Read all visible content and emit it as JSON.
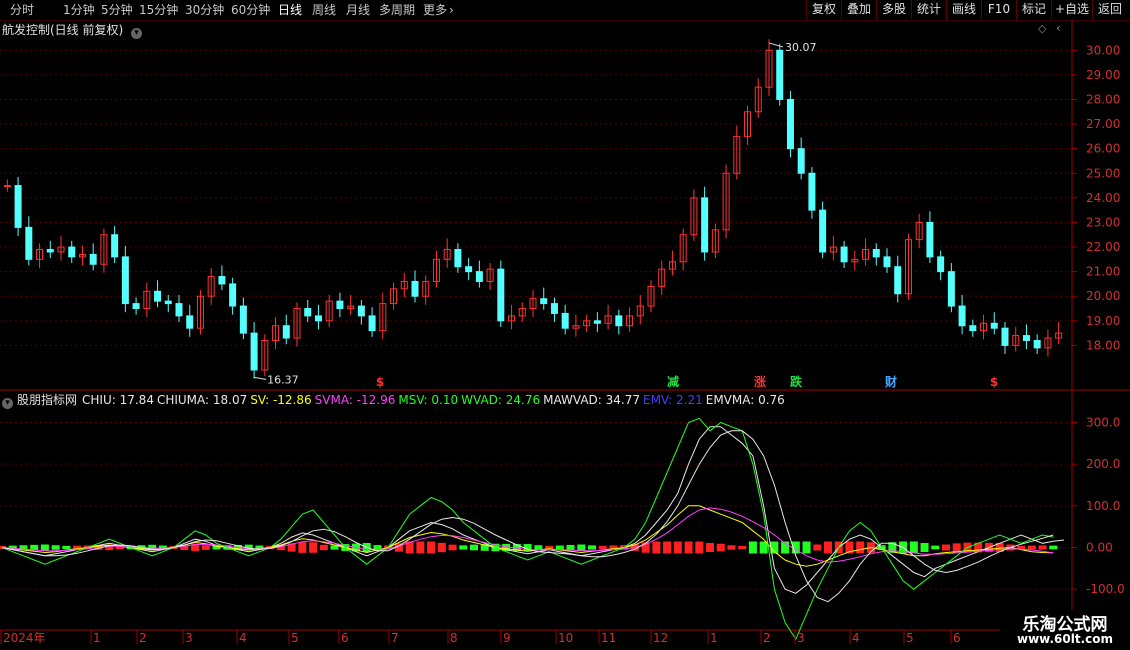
{
  "toolbar": {
    "timeframes": [
      "分时",
      "1分钟",
      "5分钟",
      "15分钟",
      "30分钟",
      "60分钟",
      "日线",
      "周线",
      "月线",
      "多周期",
      "更多"
    ],
    "active": "日线",
    "right_buttons": [
      "复权",
      "叠加",
      "多股",
      "统计",
      "画线",
      "F10",
      "标记",
      "+自选",
      "返回"
    ]
  },
  "main_panel": {
    "title": "航发控制(日线 前复权)",
    "high_label": "30.07",
    "low_label": "16.37",
    "y_ticks": [
      "30.00",
      "29.00",
      "28.00",
      "27.00",
      "26.00",
      "25.00",
      "24.00",
      "23.00",
      "22.00",
      "21.00",
      "20.00",
      "19.00",
      "18.00"
    ],
    "event_markers": [
      {
        "label": "$",
        "color": "#ff3030"
      },
      {
        "label": "减",
        "color": "#20e040"
      },
      {
        "label": "涨",
        "color": "#ff3030"
      },
      {
        "label": "跌",
        "color": "#20e040"
      },
      {
        "label": "财",
        "color": "#4aa8ff"
      },
      {
        "label": "$",
        "color": "#ff3030"
      }
    ]
  },
  "indicator_panel": {
    "name": "股朋指标网",
    "values": [
      {
        "key": "CHIU",
        "value": "17.84",
        "color": "#e8e8e8"
      },
      {
        "key": "CHIUMA",
        "value": "18.07",
        "color": "#e8e8e8"
      },
      {
        "key": "SV",
        "value": "-12.86",
        "color": "#ffff00"
      },
      {
        "key": "SVMA",
        "value": "-12.96",
        "color": "#ff40ff"
      },
      {
        "key": "MSV",
        "value": "0.10",
        "color": "#20ff20"
      },
      {
        "key": "WVAD",
        "value": "24.76",
        "color": "#20ff20"
      },
      {
        "key": "MAWVAD",
        "value": "34.77",
        "color": "#e8e8e8"
      },
      {
        "key": "EMV",
        "value": "2.21",
        "color": "#4040ff"
      },
      {
        "key": "EMVMA",
        "value": "0.76",
        "color": "#e8e8e8"
      }
    ],
    "y_ticks": [
      "300.0",
      "200.0",
      "100.0",
      "0.00",
      "-100.0"
    ]
  },
  "time_axis": {
    "labels": [
      "2024年",
      "1",
      "2",
      "3",
      "4",
      "5",
      "6",
      "7",
      "8",
      "9",
      "10",
      "11",
      "12",
      "1",
      "2",
      "3",
      "4",
      "5",
      "6"
    ]
  },
  "watermark": {
    "line1": "乐淘公式网",
    "line2": "www.60lt.com"
  },
  "chart_data": [
    {
      "type": "candlestick",
      "title": "航发控制(日线 前复权)",
      "ylim": [
        17,
        30.5
      ],
      "series": [
        {
          "name": "close",
          "values": [
            24.5,
            22.8,
            21.5,
            21.9,
            21.8,
            22.0,
            21.6,
            21.7,
            21.3,
            22.5,
            21.6,
            19.7,
            19.5,
            20.2,
            19.8,
            19.7,
            19.2,
            18.7,
            20.0,
            20.8,
            20.5,
            19.6,
            18.5,
            17.0,
            18.2,
            18.8,
            18.3,
            19.5,
            19.2,
            19.0,
            19.8,
            19.5,
            19.6,
            19.2,
            18.6,
            19.7,
            20.3,
            20.6,
            20.0,
            20.6,
            21.5,
            21.9,
            21.2,
            21.0,
            20.6,
            21.1,
            19.0,
            19.2,
            19.5,
            19.9,
            19.7,
            19.3,
            18.7,
            18.8,
            19.0,
            18.9,
            19.2,
            18.8,
            19.2,
            19.6,
            20.4,
            21.1,
            21.4,
            22.5,
            24.0,
            21.8,
            22.7,
            25.0,
            26.5,
            27.5,
            28.5,
            30.0,
            28.0,
            26.0,
            25.0,
            23.5,
            21.8,
            22.0,
            21.4,
            21.5,
            21.9,
            21.6,
            21.2,
            20.1,
            22.3,
            23.0,
            21.6,
            21.0,
            19.6,
            18.8,
            18.6,
            18.9,
            18.7,
            18.0,
            18.4,
            18.2,
            17.9,
            18.3,
            18.5
          ]
        }
      ]
    },
    {
      "type": "line",
      "title": "股朋指标网",
      "ylim": [
        -150,
        330
      ],
      "series": [
        {
          "name": "CHIU",
          "color": "#e8e8e8",
          "values": [
            0,
            -5,
            -10,
            -15,
            -20,
            -15,
            -10,
            -5,
            0,
            5,
            10,
            5,
            0,
            -5,
            -10,
            -5,
            0,
            10,
            20,
            15,
            5,
            0,
            -5,
            -10,
            -5,
            0,
            10,
            25,
            35,
            30,
            20,
            10,
            0,
            -10,
            -20,
            -10,
            0,
            20,
            40,
            50,
            60,
            55,
            45,
            30,
            20,
            10,
            0,
            -5,
            -10,
            -15,
            -10,
            -5,
            -10,
            -15,
            -20,
            -15,
            -10,
            -5,
            0,
            10,
            30,
            60,
            90,
            130,
            200,
            260,
            290,
            290,
            270,
            250,
            220,
            100,
            -50,
            -100,
            -110,
            -90,
            -60,
            -30,
            0,
            20,
            30,
            20,
            0,
            -20,
            -40,
            -60,
            -70,
            -50,
            -40,
            -30,
            -20,
            -10,
            0,
            10,
            20,
            30,
            20,
            10,
            15,
            18
          ]
        },
        {
          "name": "SV",
          "color": "#ffff00",
          "values": [
            0,
            -3,
            -6,
            -9,
            -12,
            -10,
            -6,
            -3,
            0,
            3,
            6,
            3,
            0,
            -3,
            -6,
            -3,
            0,
            6,
            12,
            9,
            3,
            0,
            -3,
            -6,
            -3,
            0,
            6,
            15,
            21,
            18,
            12,
            6,
            0,
            -6,
            -12,
            -6,
            0,
            12,
            24,
            30,
            36,
            33,
            27,
            18,
            12,
            6,
            0,
            -3,
            -6,
            -9,
            -6,
            -3,
            -6,
            -9,
            -12,
            -9,
            -6,
            -3,
            0,
            6,
            18,
            36,
            54,
            78,
            100,
            100,
            90,
            80,
            70,
            60,
            40,
            20,
            -10,
            -30,
            -40,
            -45,
            -40,
            -30,
            -20,
            -10,
            -5,
            0,
            -5,
            -10,
            -15,
            -20,
            -20,
            -15,
            -12,
            -10,
            -8,
            -6,
            -4,
            -2,
            0,
            -5,
            -10,
            -12,
            -13
          ]
        },
        {
          "name": "SVMA",
          "color": "#ff40ff",
          "values": [
            0,
            -2,
            -4,
            -6,
            -8,
            -8,
            -7,
            -5,
            -3,
            0,
            3,
            3,
            2,
            0,
            -2,
            -2,
            0,
            3,
            7,
            8,
            6,
            3,
            0,
            -3,
            -3,
            -2,
            2,
            8,
            14,
            16,
            14,
            10,
            5,
            0,
            -5,
            -5,
            -3,
            4,
            12,
            20,
            26,
            29,
            28,
            24,
            18,
            12,
            6,
            2,
            -2,
            -5,
            -6,
            -5,
            -5,
            -6,
            -8,
            -8,
            -7,
            -5,
            -3,
            0,
            8,
            20,
            35,
            55,
            75,
            90,
            95,
            92,
            85,
            75,
            62,
            48,
            30,
            10,
            -5,
            -20,
            -30,
            -35,
            -33,
            -28,
            -22,
            -15,
            -10,
            -8,
            -10,
            -13,
            -16,
            -16,
            -15,
            -13,
            -11,
            -9,
            -7,
            -5,
            -3,
            -4,
            -6,
            -9,
            -13
          ]
        },
        {
          "name": "WVAD",
          "color": "#20ff20",
          "values": [
            0,
            -10,
            -20,
            -30,
            -40,
            -30,
            -20,
            -10,
            0,
            10,
            20,
            10,
            0,
            -10,
            -20,
            -10,
            0,
            20,
            40,
            30,
            10,
            0,
            -10,
            -20,
            -10,
            0,
            20,
            50,
            80,
            90,
            60,
            30,
            0,
            -20,
            -40,
            -20,
            0,
            40,
            80,
            100,
            120,
            110,
            90,
            60,
            40,
            20,
            0,
            -10,
            -20,
            -30,
            -20,
            -10,
            -20,
            -30,
            -40,
            -30,
            -20,
            -10,
            0,
            20,
            60,
            120,
            180,
            240,
            300,
            310,
            280,
            300,
            290,
            280,
            200,
            80,
            -100,
            -180,
            -220,
            -160,
            -100,
            -50,
            0,
            40,
            60,
            40,
            0,
            -40,
            -80,
            -100,
            -80,
            -60,
            -40,
            -20,
            0,
            10,
            20,
            30,
            20,
            10,
            20,
            30,
            25
          ]
        },
        {
          "name": "MAWVAD",
          "color": "#e8e8e8",
          "values": [
            0,
            -5,
            -10,
            -15,
            -20,
            -20,
            -18,
            -14,
            -8,
            -2,
            4,
            6,
            4,
            0,
            -4,
            -4,
            0,
            6,
            14,
            18,
            16,
            10,
            4,
            -2,
            -4,
            -2,
            4,
            14,
            28,
            40,
            44,
            38,
            26,
            12,
            0,
            -8,
            -8,
            4,
            20,
            38,
            56,
            68,
            72,
            68,
            58,
            44,
            30,
            18,
            6,
            -4,
            -10,
            -12,
            -14,
            -16,
            -20,
            -22,
            -22,
            -18,
            -12,
            -4,
            10,
            32,
            62,
            100,
            150,
            200,
            240,
            270,
            280,
            280,
            260,
            220,
            150,
            60,
            -20,
            -80,
            -120,
            -130,
            -110,
            -80,
            -40,
            -10,
            10,
            10,
            0,
            -20,
            -40,
            -55,
            -60,
            -55,
            -45,
            -35,
            -22,
            -10,
            0,
            8,
            15,
            22,
            30
          ]
        },
        {
          "name": "MSV",
          "color": "#20ff20",
          "values": [
            0,
            1,
            2,
            2,
            1,
            0,
            -1,
            -2,
            -2,
            -1,
            0,
            1,
            2,
            2,
            1,
            0,
            -1,
            -2,
            -2,
            -1,
            0,
            1,
            2,
            2,
            1,
            0,
            -1,
            -2,
            -2,
            -1,
            0,
            1,
            2,
            2,
            1,
            0,
            -1,
            -2,
            -2,
            -1,
            0,
            1,
            2,
            2,
            1,
            0,
            -1,
            -2,
            -2,
            -1,
            0,
            1,
            2,
            2,
            1,
            0,
            -1,
            -2,
            -2,
            -1,
            0,
            5,
            10,
            15,
            20,
            15,
            10,
            5,
            0,
            -5,
            -10,
            -15,
            -20,
            -25,
            -20,
            -15,
            -10,
            -5,
            0,
            2,
            4,
            2,
            0,
            -2,
            -4,
            -2,
            0,
            2,
            4,
            2,
            0,
            -2,
            -4,
            -2,
            0,
            1,
            1,
            0,
            0
          ]
        }
      ]
    }
  ]
}
